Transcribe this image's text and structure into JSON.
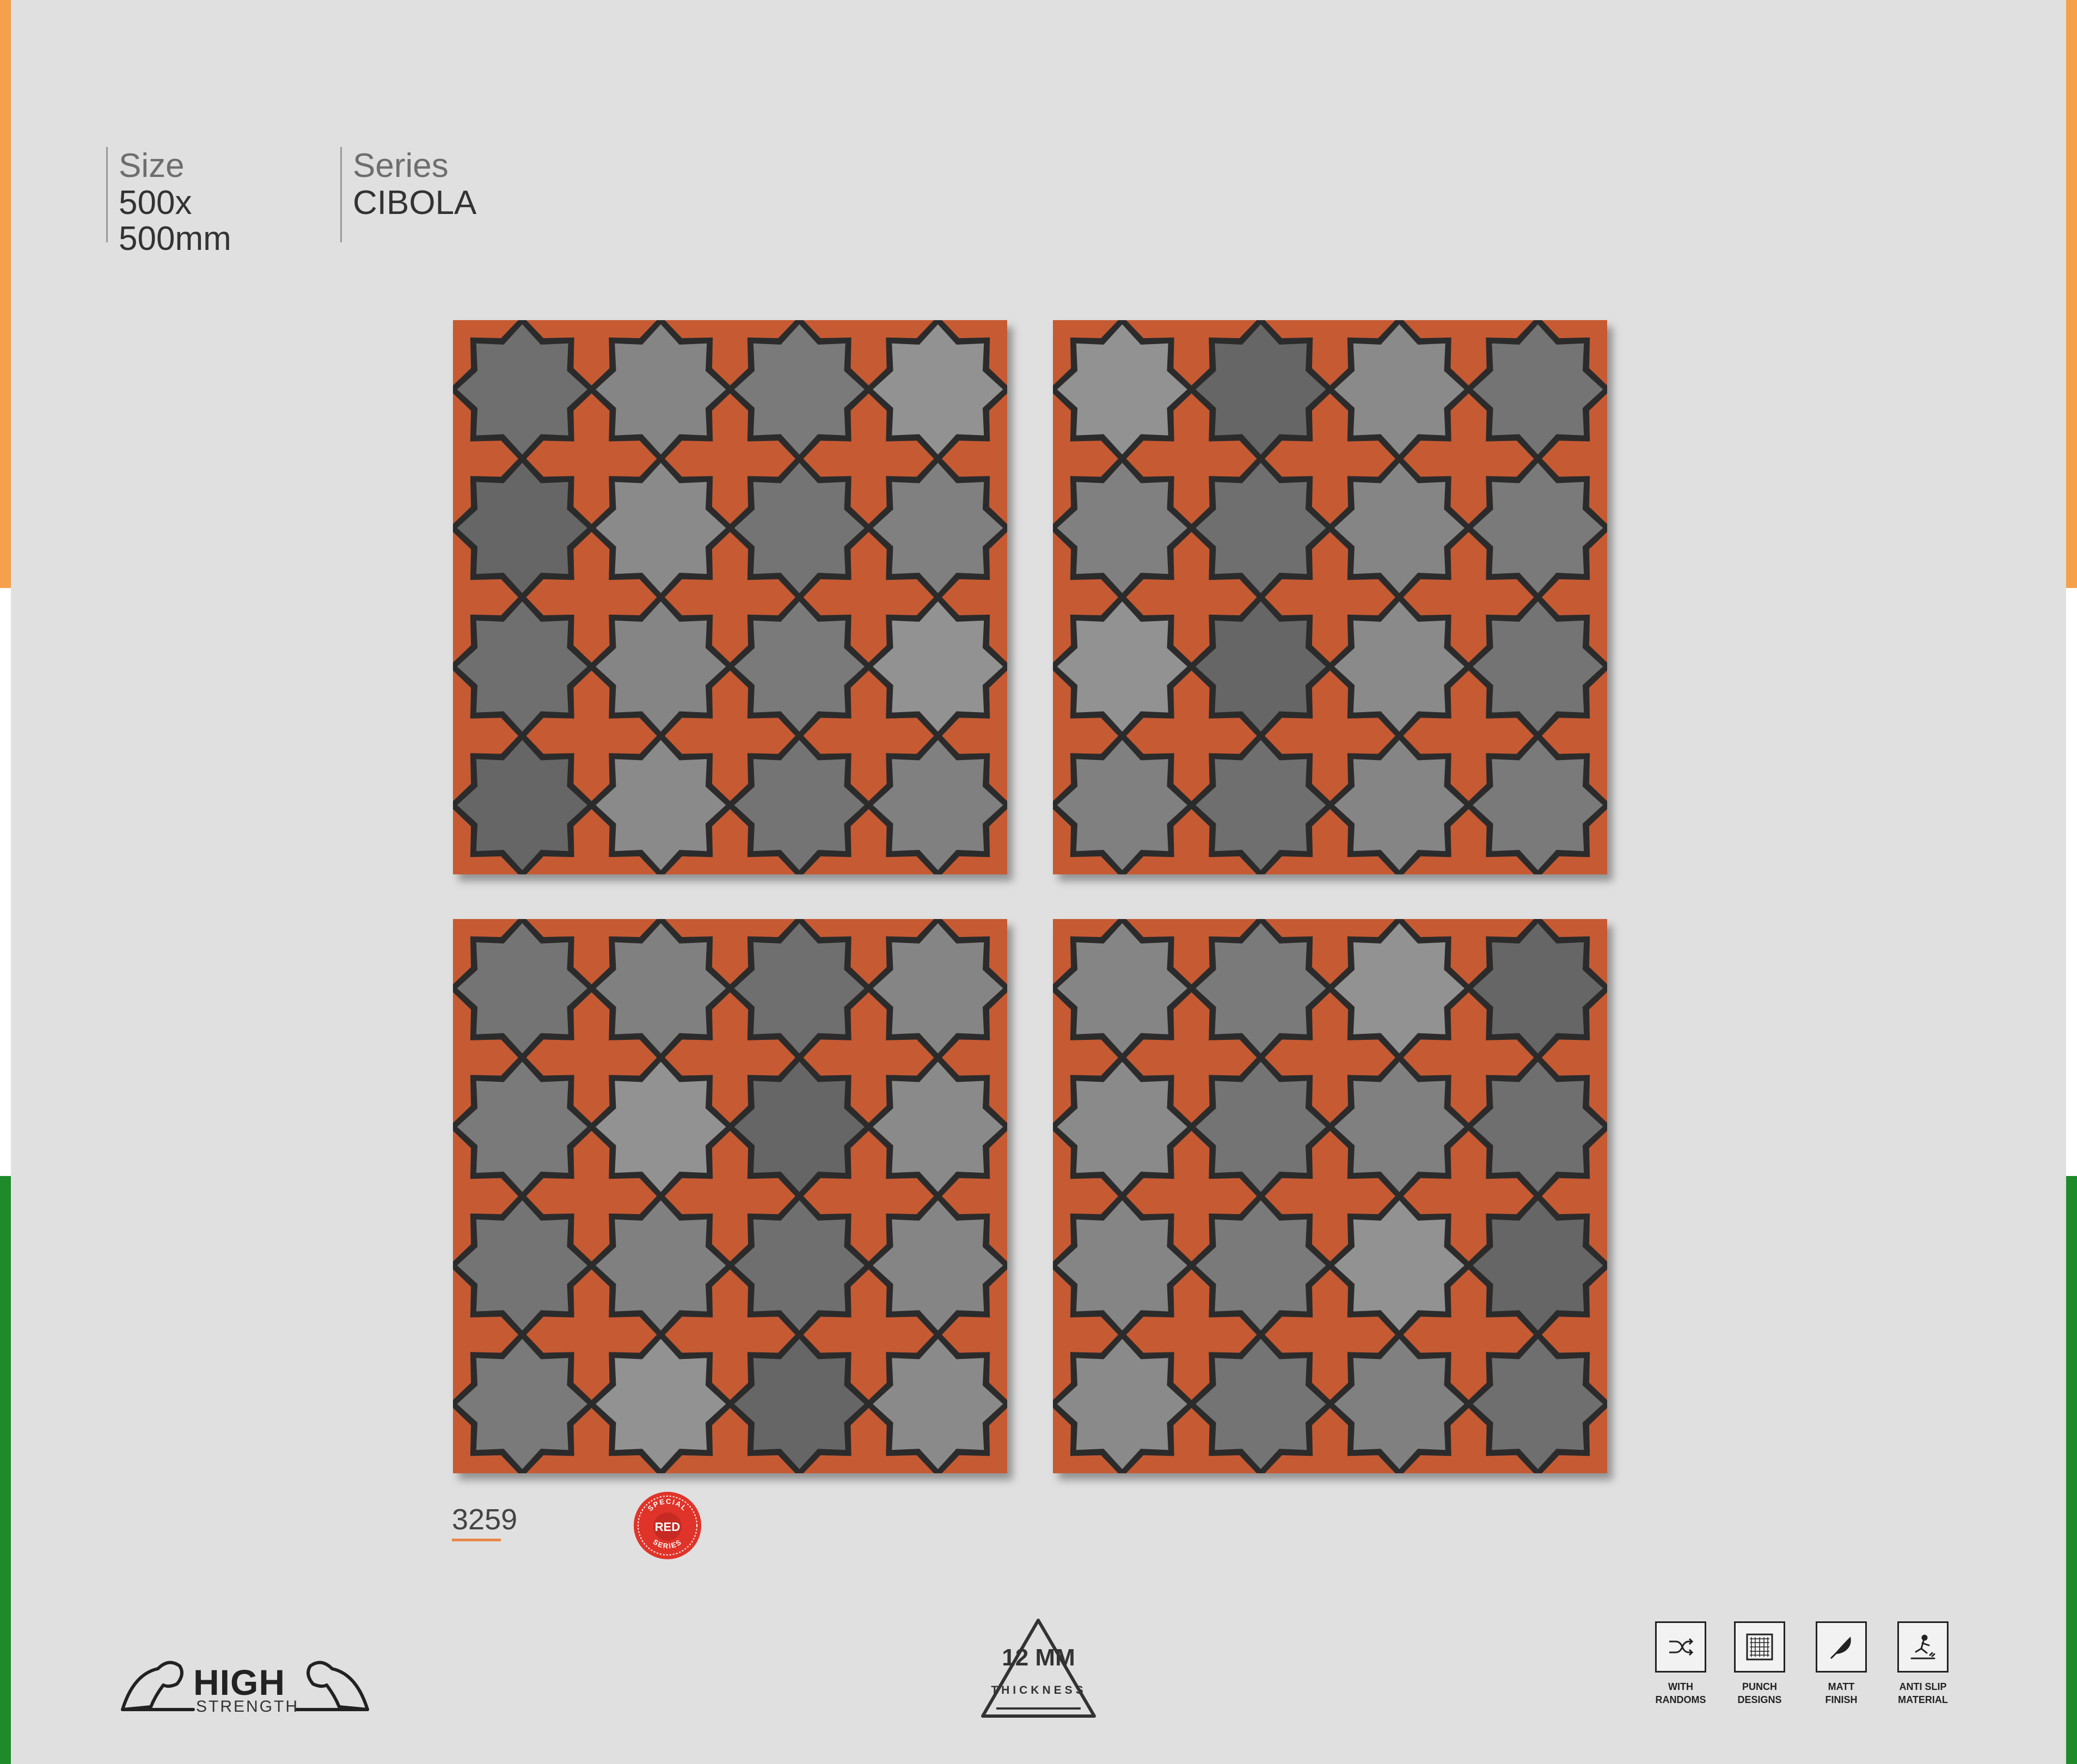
{
  "colors": {
    "background": "#e0e0e0",
    "saffron": "#f5a04a",
    "green": "#1e8a2a",
    "terracotta": "#c65a33",
    "grey_star": "#7d7d7d",
    "grout": "#2b2b2b",
    "accent_underline": "#e8874a",
    "badge_red": "#e0342a"
  },
  "spec": {
    "size_label": "Size",
    "size_value_line1": "500x",
    "size_value_line2": "500mm",
    "series_label": "Series",
    "series_value": "CIBOLA"
  },
  "product": {
    "code": "3259",
    "badge_top": "SPECIAL",
    "badge_center": "RED",
    "badge_bottom": "SERIES"
  },
  "strength_logo": {
    "high": "HIGH",
    "strength": "STRENGTH"
  },
  "thickness": {
    "value": "12 MM",
    "label": "THICKNESS"
  },
  "features": [
    {
      "icon": "shuffle-icon",
      "label": "WITH\nRANDOMS"
    },
    {
      "icon": "grid-icon",
      "label": "PUNCH\nDESIGNS"
    },
    {
      "icon": "feather-icon",
      "label": "MATT\nFINISH"
    },
    {
      "icon": "anti-slip-icon",
      "label": "ANTI SLIP\nMATERIAL"
    }
  ]
}
